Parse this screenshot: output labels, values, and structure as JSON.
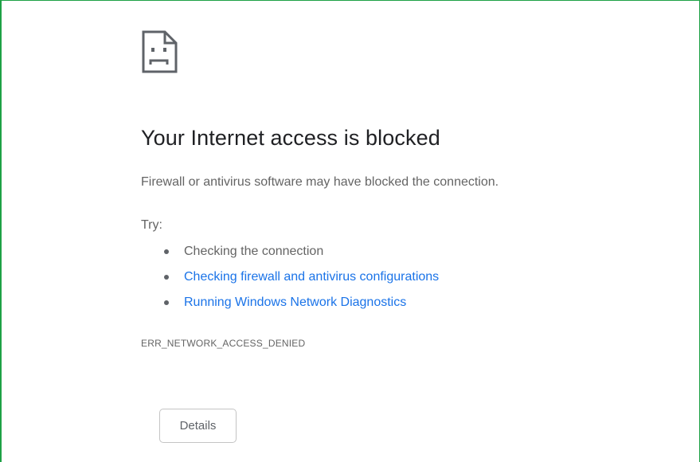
{
  "error_page": {
    "icon": "sad-page-icon",
    "title": "Your Internet access is blocked",
    "summary": "Firewall or antivirus software may have blocked the connection.",
    "try_label": "Try:",
    "suggestions": [
      {
        "text": "Checking the connection",
        "is_link": false
      },
      {
        "text": "Checking firewall and antivirus configurations",
        "is_link": true
      },
      {
        "text": "Running Windows Network Diagnostics",
        "is_link": true
      }
    ],
    "error_code": "ERR_NETWORK_ACCESS_DENIED",
    "details_button_label": "Details"
  },
  "colors": {
    "frame_border": "#1ea145",
    "title_text": "#202124",
    "body_text": "#646464",
    "link": "#1a73e8",
    "button_border": "#c4c4c4"
  }
}
